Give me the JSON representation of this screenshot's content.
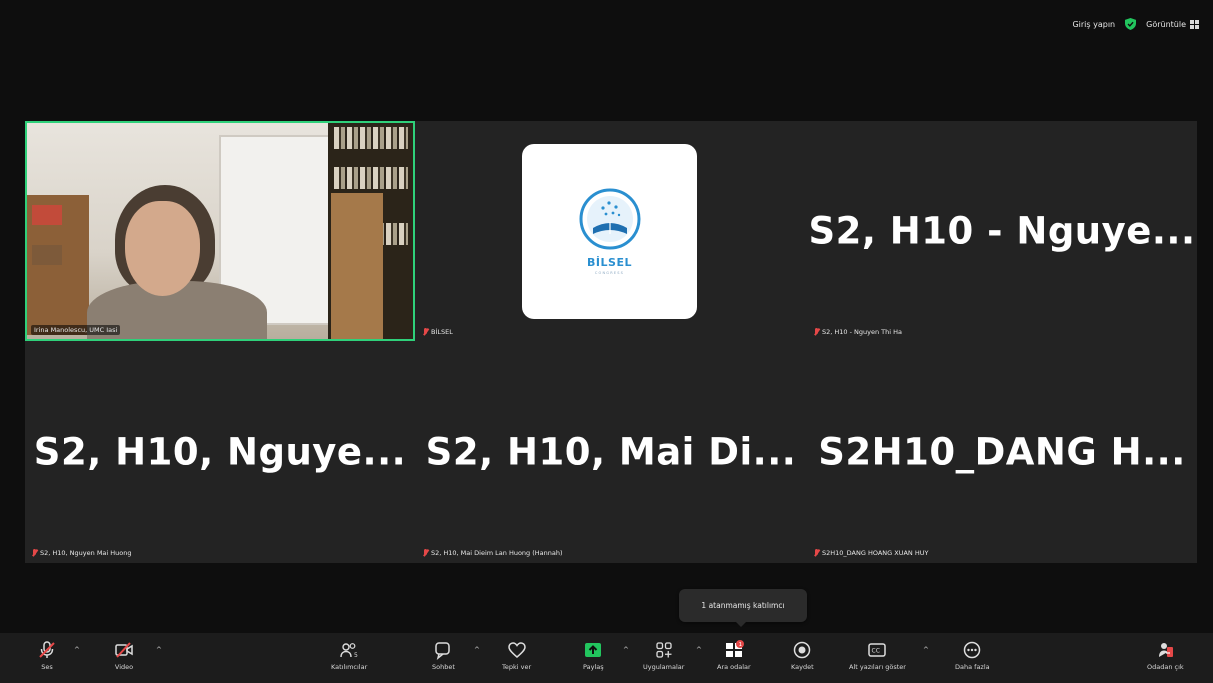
{
  "topbar": {
    "signin_label": "Giriş yapın",
    "view_label": "Görüntüle"
  },
  "tiles": [
    {
      "id": "speaker",
      "label": "Irina Manolescu, UMC Iasi",
      "muted": false,
      "active": true
    },
    {
      "id": "bilsel",
      "label": "BİLSEL",
      "muted": true,
      "logo": {
        "brand": "BİLSEL",
        "tag": "CONGRESS"
      }
    },
    {
      "id": "p3",
      "big_name": "S2, H10 - Nguye...",
      "label": "S2, H10 - Nguyen Thi Ha",
      "muted": true
    },
    {
      "id": "p4",
      "big_name": "S2, H10, Nguye...",
      "label": "S2, H10, Nguyen Mai Huong",
      "muted": true
    },
    {
      "id": "p5",
      "big_name": "S2, H10, Mai Di...",
      "label": "S2, H10, Mai Dieim Lan Huong (Hannah)",
      "muted": true
    },
    {
      "id": "p6",
      "big_name": "S2H10_DANG H...",
      "label": "S2H10_DANG HOANG XUAN HUY",
      "muted": true
    }
  ],
  "tooltip": {
    "text": "1 atanmamış katılımcı"
  },
  "toolbar": {
    "mic_label": "Ses",
    "video_label": "Video",
    "participants_label": "Katılımcılar",
    "participants_count": "5",
    "chat_label": "Sohbet",
    "react_label": "Tepki ver",
    "share_label": "Paylaş",
    "apps_label": "Uygulamalar",
    "rooms_label": "Ara odalar",
    "rooms_badge": "1",
    "record_label": "Kaydet",
    "captions_label": "Alt yazıları göster",
    "more_label": "Daha fazla",
    "leave_label": "Odadan çık"
  },
  "colors": {
    "active_border": "#2fd07a",
    "share_green": "#22c55e",
    "muted_red": "#e54848",
    "background": "#0e0e0e",
    "tile_bg": "#232323"
  }
}
